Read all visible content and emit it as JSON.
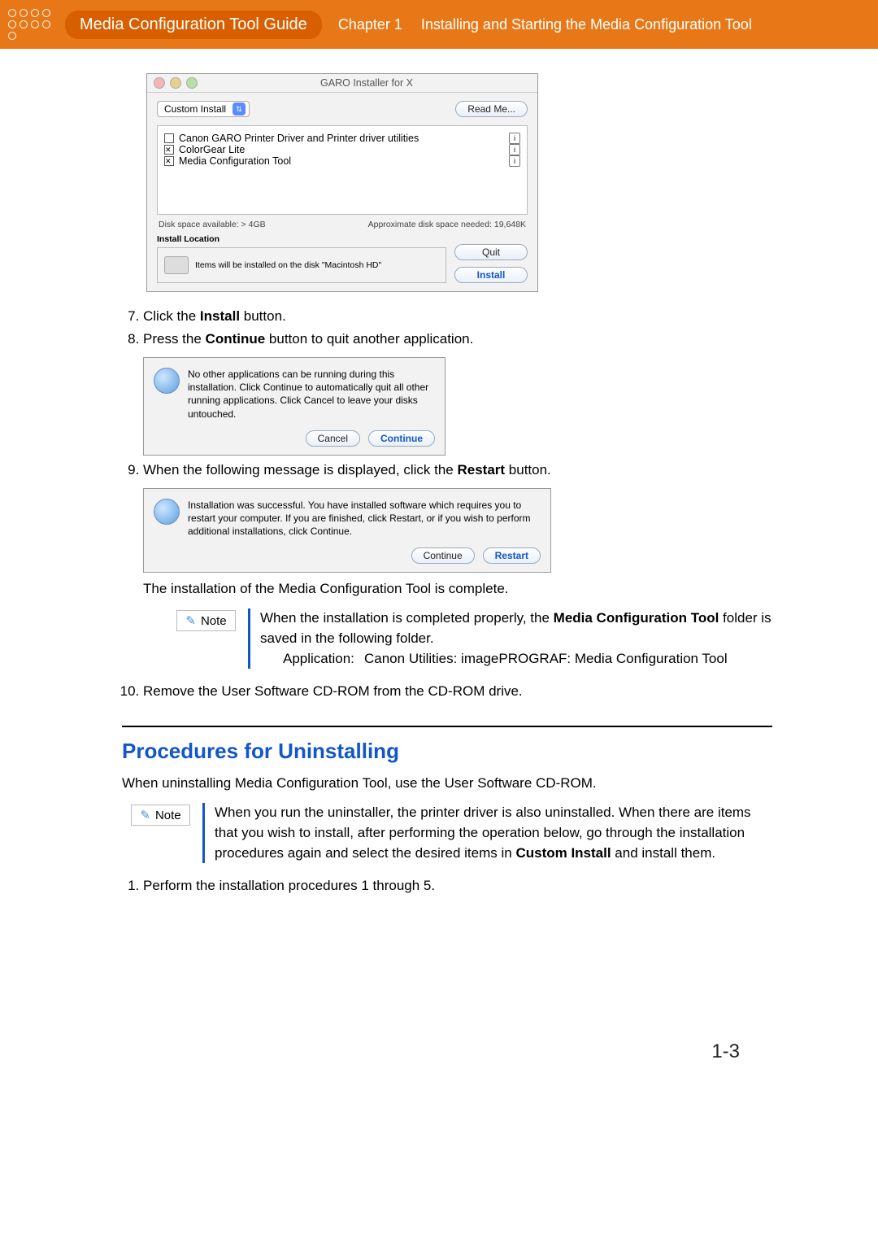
{
  "header": {
    "guide_title": "Media Configuration Tool Guide",
    "chapter_label": "Chapter 1",
    "chapter_title": "Installing and Starting the Media Configuration Tool"
  },
  "installer_window": {
    "title": "GARO Installer for X",
    "install_type": "Custom Install",
    "readme_btn": "Read Me...",
    "items": [
      {
        "label": "Canon GARO Printer Driver and Printer driver utilities",
        "checked": false
      },
      {
        "label": "ColorGear Lite",
        "checked": true
      },
      {
        "label": "Media Configuration Tool",
        "checked": true
      }
    ],
    "disk_avail": "Disk space available: > 4GB",
    "disk_needed": "Approximate disk space needed: 19,648K",
    "install_loc_heading": "Install Location",
    "install_loc_text": "Items will be installed on the disk \"Macintosh HD\"",
    "quit_btn": "Quit",
    "install_btn": "Install"
  },
  "steps": {
    "s7a": "Click the ",
    "s7b": "Install",
    "s7c": " button.",
    "s8a": "Press the ",
    "s8b": "Continue",
    "s8c": " button to quit another application.",
    "s9a": "When the following message is displayed, click the ",
    "s9b": "Restart",
    "s9c": " button.",
    "s10": "Remove the User Software CD-ROM from the CD-ROM drive."
  },
  "dlg_continue": {
    "text": "No other applications can be running during this installation.  Click Continue to automatically quit all other running applications.  Click Cancel to leave your disks untouched.",
    "cancel": "Cancel",
    "cont": "Continue"
  },
  "dlg_restart": {
    "text": "Installation was successful. You have installed software which requires you to restart your computer. If you are finished, click Restart, or if you wish to perform additional installations, click Continue.",
    "cont": "Continue",
    "restart": "Restart"
  },
  "complete_line": "The installation of the Media Configuration Tool is complete.",
  "note_label": "Note",
  "note1": {
    "line_a": "When the installation is completed properly, the ",
    "bold": "Media Configuration Tool",
    "line_b": " folder is saved in the following folder.",
    "app_label": "Application:",
    "app_path": "Canon Utilities: imagePROGRAF: Media Configuration Tool"
  },
  "uninstall": {
    "heading": "Procedures for Uninstalling",
    "intro": "When uninstalling Media Configuration Tool, use the User Software CD-ROM.",
    "note_a": "When you run the uninstaller, the printer driver is also uninstalled. When there are items that you wish to install, after performing the operation below, go through the installation procedures again and select the desired items in ",
    "note_bold": "Custom Install",
    "note_b": " and install them.",
    "step1": "Perform the installation procedures 1 through 5."
  },
  "page_number": "1-3"
}
